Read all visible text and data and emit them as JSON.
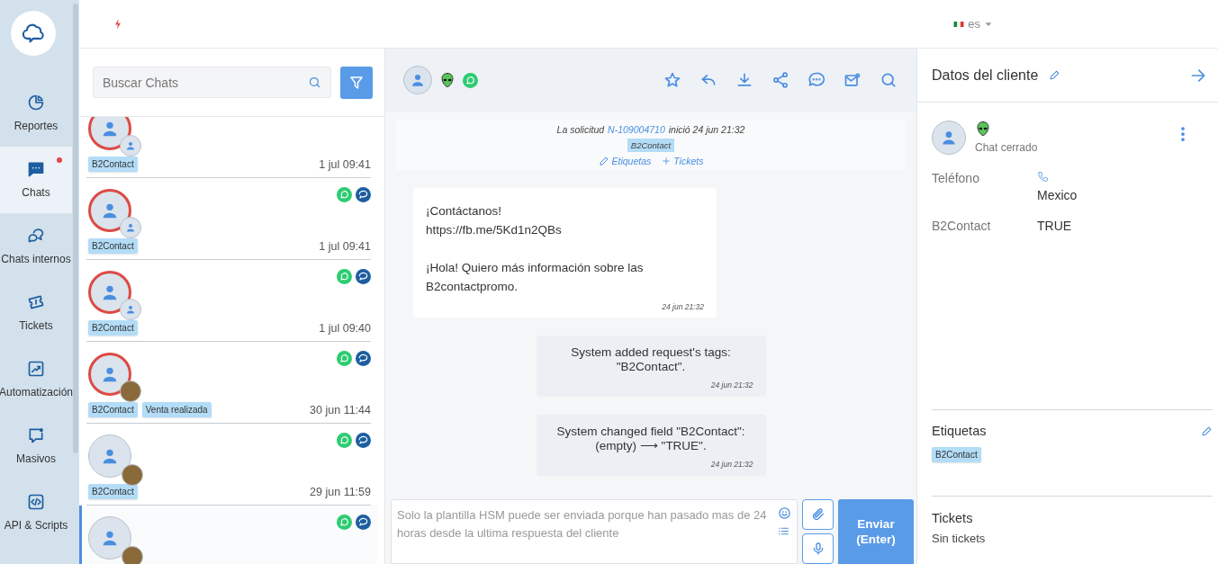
{
  "topbar": {
    "language": "es"
  },
  "sidebar": {
    "items": [
      {
        "label": "Reportes",
        "selected": false,
        "notification": false
      },
      {
        "label": "Chats",
        "selected": true,
        "notification": true
      },
      {
        "label": "Chats internos",
        "selected": false,
        "notification": false
      },
      {
        "label": "Tickets",
        "selected": false,
        "notification": false
      },
      {
        "label": "Automatización",
        "selected": false,
        "notification": false
      },
      {
        "label": "Masivos",
        "selected": false,
        "notification": false
      },
      {
        "label": "API & Scripts",
        "selected": false,
        "notification": false
      }
    ]
  },
  "chat_list": {
    "search": {
      "placeholder": "Buscar Chats"
    },
    "chats": [
      {
        "ring": true,
        "kind": "person",
        "channels": false,
        "tags": [
          "B2Contact"
        ],
        "time": "1 jul 09:41",
        "selected": false
      },
      {
        "ring": true,
        "kind": "person",
        "channels": true,
        "tags": [
          "B2Contact"
        ],
        "time": "1 jul 09:41",
        "selected": false
      },
      {
        "ring": true,
        "kind": "person",
        "channels": true,
        "tags": [
          "B2Contact"
        ],
        "time": "1 jul 09:40",
        "selected": false
      },
      {
        "ring": true,
        "kind": "photo",
        "channels": true,
        "tags": [
          "B2Contact",
          "Venta realizada"
        ],
        "time": "30 jun 11:44",
        "selected": false
      },
      {
        "ring": false,
        "kind": "photo",
        "channels": true,
        "tags": [
          "B2Contact"
        ],
        "time": "29 jun 11:59",
        "selected": false
      },
      {
        "ring": false,
        "kind": "photo",
        "channels": true,
        "selected": true
      }
    ]
  },
  "conversation": {
    "request": {
      "prefix": "La solicitud",
      "id": "N-109004710",
      "suffix": "inició 24 jun 21:32",
      "tag": "B2Contact",
      "actions": [
        {
          "kind": "edit",
          "label": "Etiquetas"
        },
        {
          "kind": "add",
          "label": "Tickets"
        }
      ]
    },
    "messages": [
      {
        "kind": "incoming",
        "text": "¡Contáctanos!\nhttps://fb.me/5Kd1n2QBs\n\n¡Hola! Quiero más información sobre las\nB2contactpromo.",
        "time": "24 jun 21:32"
      },
      {
        "kind": "system",
        "text": "System added request's tags:\n\"B2Contact\".",
        "time": "24 jun 21:32"
      },
      {
        "kind": "system",
        "text": "System changed field \"B2Contact\":\n(empty) ⟶ \"TRUE\".",
        "time": "24 jun 21:32"
      }
    ],
    "composer": {
      "placeholder": "Solo la plantilla HSM puede ser enviada porque han pasado mas de 24 horas desde la ultima respuesta del cliente",
      "send": "Enviar\n(Enter)"
    }
  },
  "client": {
    "title": "Datos del cliente",
    "status": "Chat cerrado",
    "fields": [
      {
        "label": "Teléfono",
        "phone": true,
        "value": "Mexico"
      },
      {
        "label": "B2Contact",
        "phone": false,
        "value": "TRUE"
      }
    ],
    "tags_title": "Etiquetas",
    "tags": [
      "B2Contact"
    ],
    "tickets_title": "Tickets",
    "tickets_empty": "Sin tickets"
  }
}
